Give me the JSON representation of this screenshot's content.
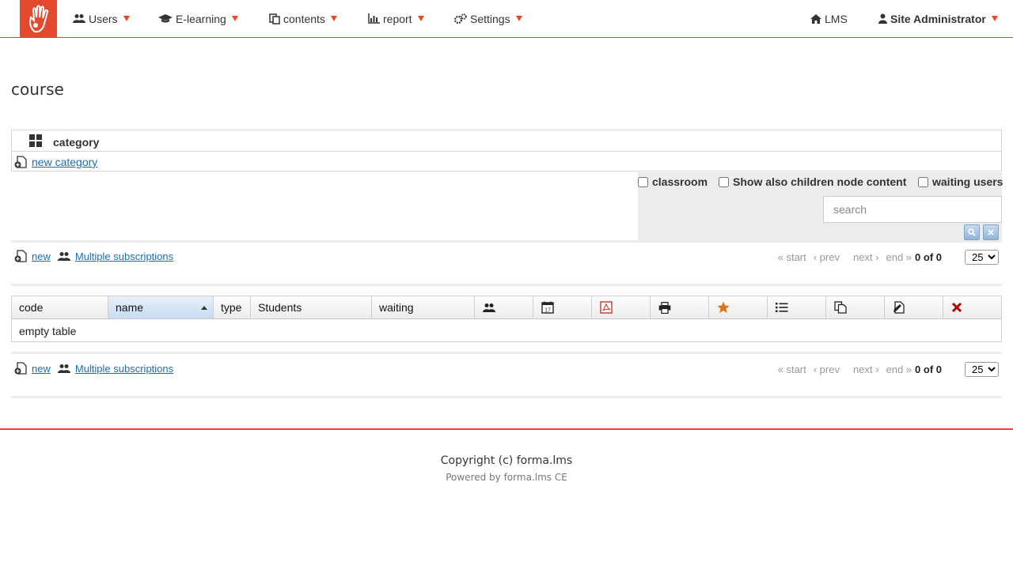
{
  "nav": {
    "users": "Users",
    "elearning": "E-learning",
    "contents": "contents",
    "report": "report",
    "settings": "Settings",
    "lms": "LMS",
    "admin": "Site Administrator"
  },
  "page": {
    "title": "course"
  },
  "category": {
    "header": "category",
    "new_label": "new category"
  },
  "filter": {
    "classroom": "classroom",
    "children": "Show also children node content",
    "waiting": "waiting users",
    "search_placeholder": "search"
  },
  "actions": {
    "new": "new",
    "multi": "Multiple subscriptions"
  },
  "paging": {
    "start": "« start",
    "prev": "‹ prev",
    "next": "next ›",
    "end": "end »",
    "count": "0 of 0",
    "page_size": "25"
  },
  "table": {
    "headers": [
      "code",
      "name",
      "type",
      "Students",
      "waiting"
    ],
    "empty": "empty table"
  },
  "footer": {
    "copyright": "Copyright (c) forma.lms",
    "powered": "Powered by forma.lms CE"
  },
  "colors": {
    "accent": "#e2492d",
    "link": "#1a6fb3"
  }
}
